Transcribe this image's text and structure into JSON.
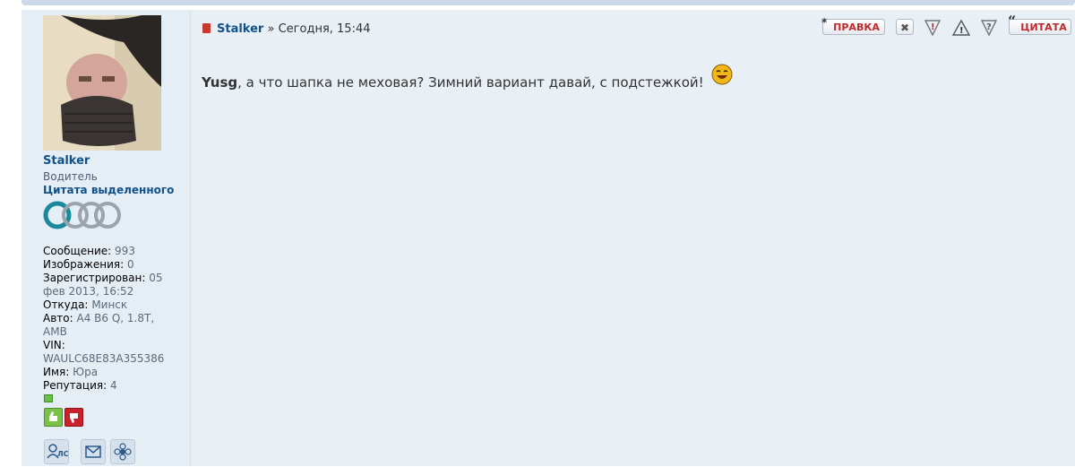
{
  "post": {
    "author": "Stalker",
    "separator": "»",
    "time": "Сегодня, 15:44",
    "message_name": "Yusg",
    "message_text": ", а что шапка не меховая? Зимний вариант давай, с подстежкой!",
    "buttons": {
      "edit": "ПРАВКА",
      "delete_icon": "close-icon",
      "report_icon": "report-icon",
      "warn_icon": "warning-icon",
      "info_icon": "info-icon",
      "quote": "ЦИТАТА"
    }
  },
  "profile": {
    "username": "Stalker",
    "rank": "Водитель",
    "special_rank": "Цитата выделенного",
    "fields": [
      {
        "label": "Сообщение:",
        "value": "993"
      },
      {
        "label": "Изображения:",
        "value": "0"
      },
      {
        "label": "Зарегистрирован:",
        "value": "05 фев 2013, 16:52"
      },
      {
        "label": "Откуда:",
        "value": "Минск"
      },
      {
        "label": "Авто:",
        "value": "A4 B6 Q, 1.8T, AMB"
      },
      {
        "label": "VIN:",
        "value": "WAULC68E83A355386"
      },
      {
        "label": "Имя:",
        "value": "Юра"
      },
      {
        "label": "Репутация:",
        "value": "4"
      }
    ],
    "contacts": {
      "pm_label": "ЛС",
      "mail_icon": "envelope-icon",
      "web_icon": "website-icon"
    }
  },
  "colors": {
    "link": "#105289",
    "post_bg": "#e8eff5",
    "button_text": "#c0282c"
  }
}
